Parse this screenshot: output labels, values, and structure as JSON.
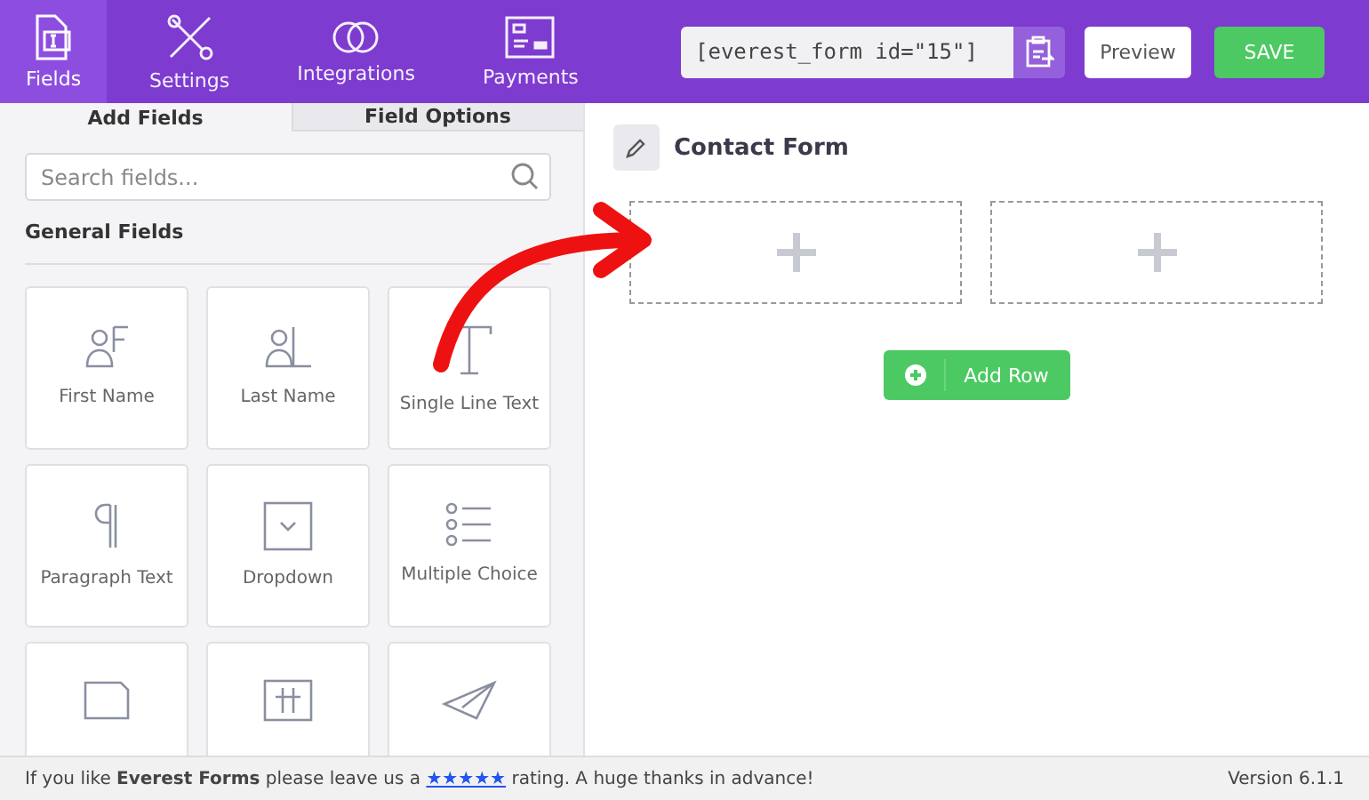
{
  "nav": [
    {
      "label": "Fields",
      "kind": "fields",
      "selected": true
    },
    {
      "label": "Settings",
      "kind": "settings",
      "selected": false
    },
    {
      "label": "Integrations",
      "kind": "integrations",
      "selected": false
    },
    {
      "label": "Payments",
      "kind": "payments",
      "selected": false
    }
  ],
  "shortcode": "[everest_form id=\"15\"]",
  "buttons": {
    "preview": "Preview",
    "save": "SAVE"
  },
  "panel_tabs": [
    {
      "label": "Add Fields",
      "selected": true
    },
    {
      "label": "Field Options",
      "selected": false
    }
  ],
  "search": {
    "placeholder": "Search fields..."
  },
  "section_title": "General Fields",
  "fields": [
    {
      "kind": "first-name",
      "label": "First Name"
    },
    {
      "kind": "last-name",
      "label": "Last Name"
    },
    {
      "kind": "text",
      "label": "Single Line Text"
    },
    {
      "kind": "paragraph",
      "label": "Paragraph Text"
    },
    {
      "kind": "dropdown",
      "label": "Dropdown"
    },
    {
      "kind": "choice",
      "label": "Multiple Choice"
    },
    {
      "kind": "card"
    },
    {
      "kind": "number"
    },
    {
      "kind": "send"
    }
  ],
  "form": {
    "title": "Contact Form",
    "drop_zones": [
      {
        "kind": "empty"
      },
      {
        "kind": "empty"
      }
    ],
    "add_row": "Add Row"
  },
  "footer": {
    "before": "If you like **Everest Forms** please leave us a",
    "link": "★★★★★",
    "after": "rating. A huge thanks in advance!",
    "version": "Version 6.1.1"
  }
}
